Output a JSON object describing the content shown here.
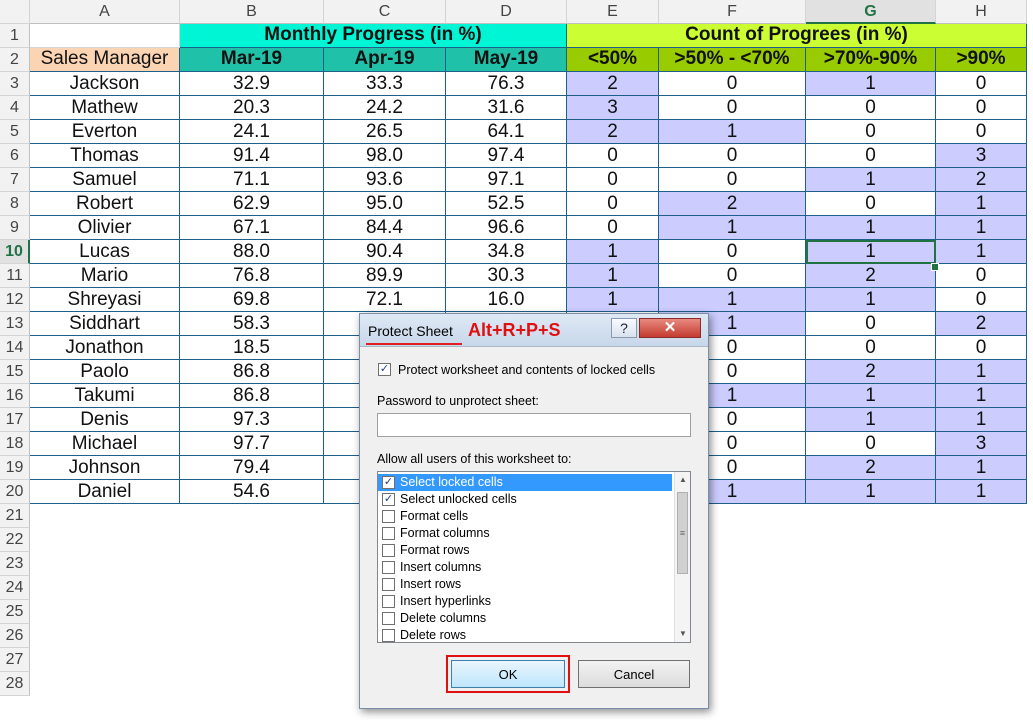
{
  "columns": [
    "A",
    "B",
    "C",
    "D",
    "E",
    "F",
    "G",
    "H"
  ],
  "selected_column": "G",
  "selected_row": 10,
  "row_numbers": [
    1,
    2,
    3,
    4,
    5,
    6,
    7,
    8,
    9,
    10,
    11,
    12,
    13,
    14,
    15,
    16,
    17,
    18,
    19,
    20,
    21,
    22,
    23,
    24,
    25,
    26,
    27,
    28
  ],
  "header1": {
    "monthly": "Monthly Progress (in %)",
    "count": "Count of Progrees (in %)"
  },
  "header2": {
    "manager": "Sales Manager",
    "mar": "Mar-19",
    "apr": "Apr-19",
    "may": "May-19",
    "lt50": "<50%",
    "r50_70": ">50% - <70%",
    "r70_90": ">70%-90%",
    "gt90": ">90%"
  },
  "colors": {
    "monthly_header": "#00f5d4",
    "count_header": "#ccff33",
    "month_header": "#1fc2a8",
    "bucket_header": "#99cc00",
    "manager_header": "#fbd4b4",
    "highlight": "#ccccff",
    "selection": "#217346"
  },
  "rows": [
    {
      "name": "Jackson",
      "mar": "32.9",
      "apr": "33.3",
      "may": "76.3",
      "b1": "2",
      "b2": "0",
      "b3": "1",
      "b4": "0"
    },
    {
      "name": "Mathew",
      "mar": "20.3",
      "apr": "24.2",
      "may": "31.6",
      "b1": "3",
      "b2": "0",
      "b3": "0",
      "b4": "0"
    },
    {
      "name": "Everton",
      "mar": "24.1",
      "apr": "26.5",
      "may": "64.1",
      "b1": "2",
      "b2": "1",
      "b3": "0",
      "b4": "0"
    },
    {
      "name": "Thomas",
      "mar": "91.4",
      "apr": "98.0",
      "may": "97.4",
      "b1": "0",
      "b2": "0",
      "b3": "0",
      "b4": "3"
    },
    {
      "name": "Samuel",
      "mar": "71.1",
      "apr": "93.6",
      "may": "97.1",
      "b1": "0",
      "b2": "0",
      "b3": "1",
      "b4": "2"
    },
    {
      "name": "Robert",
      "mar": "62.9",
      "apr": "95.0",
      "may": "52.5",
      "b1": "0",
      "b2": "2",
      "b3": "0",
      "b4": "1"
    },
    {
      "name": "Olivier",
      "mar": "67.1",
      "apr": "84.4",
      "may": "96.6",
      "b1": "0",
      "b2": "1",
      "b3": "1",
      "b4": "1"
    },
    {
      "name": "Lucas",
      "mar": "88.0",
      "apr": "90.4",
      "may": "34.8",
      "b1": "1",
      "b2": "0",
      "b3": "1",
      "b4": "1"
    },
    {
      "name": "Mario",
      "mar": "76.8",
      "apr": "89.9",
      "may": "30.3",
      "b1": "1",
      "b2": "0",
      "b3": "2",
      "b4": "0"
    },
    {
      "name": "Shreyasi",
      "mar": "69.8",
      "apr": "72.1",
      "may": "16.0",
      "b1": "1",
      "b2": "1",
      "b3": "1",
      "b4": "0"
    },
    {
      "name": "Siddhart",
      "mar": "58.3",
      "apr": "",
      "may": "",
      "b1": "",
      "b2": "1",
      "b3": "0",
      "b4": "2"
    },
    {
      "name": "Jonathon",
      "mar": "18.5",
      "apr": "",
      "may": "",
      "b1": "",
      "b2": "0",
      "b3": "0",
      "b4": "0"
    },
    {
      "name": "Paolo",
      "mar": "86.8",
      "apr": "",
      "may": "",
      "b1": "",
      "b2": "0",
      "b3": "2",
      "b4": "1"
    },
    {
      "name": "Takumi",
      "mar": "86.8",
      "apr": "",
      "may": "",
      "b1": "",
      "b2": "1",
      "b3": "1",
      "b4": "1"
    },
    {
      "name": "Denis",
      "mar": "97.3",
      "apr": "",
      "may": "",
      "b1": "",
      "b2": "0",
      "b3": "1",
      "b4": "1"
    },
    {
      "name": "Michael",
      "mar": "97.7",
      "apr": "",
      "may": "",
      "b1": "",
      "b2": "0",
      "b3": "0",
      "b4": "3"
    },
    {
      "name": "Johnson",
      "mar": "79.4",
      "apr": "",
      "may": "",
      "b1": "",
      "b2": "0",
      "b3": "2",
      "b4": "1"
    },
    {
      "name": "Daniel",
      "mar": "54.6",
      "apr": "",
      "may": "",
      "b1": "",
      "b2": "1",
      "b3": "1",
      "b4": "1"
    }
  ],
  "dialog": {
    "title": "Protect Sheet",
    "shortcut": "Alt+R+P+S",
    "help_label": "?",
    "close_label": "✕",
    "protect_label": "Protect worksheet and contents of locked cells",
    "protect_checked": true,
    "password_label": "Password to unprotect sheet:",
    "password_value": "",
    "allow_label": "Allow all users of this worksheet to:",
    "permissions": [
      {
        "label": "Select locked cells",
        "checked": true,
        "selected": true
      },
      {
        "label": "Select unlocked cells",
        "checked": true,
        "selected": false
      },
      {
        "label": "Format cells",
        "checked": false,
        "selected": false
      },
      {
        "label": "Format columns",
        "checked": false,
        "selected": false
      },
      {
        "label": "Format rows",
        "checked": false,
        "selected": false
      },
      {
        "label": "Insert columns",
        "checked": false,
        "selected": false
      },
      {
        "label": "Insert rows",
        "checked": false,
        "selected": false
      },
      {
        "label": "Insert hyperlinks",
        "checked": false,
        "selected": false
      },
      {
        "label": "Delete columns",
        "checked": false,
        "selected": false
      },
      {
        "label": "Delete rows",
        "checked": false,
        "selected": false
      }
    ],
    "ok_label": "OK",
    "cancel_label": "Cancel"
  }
}
